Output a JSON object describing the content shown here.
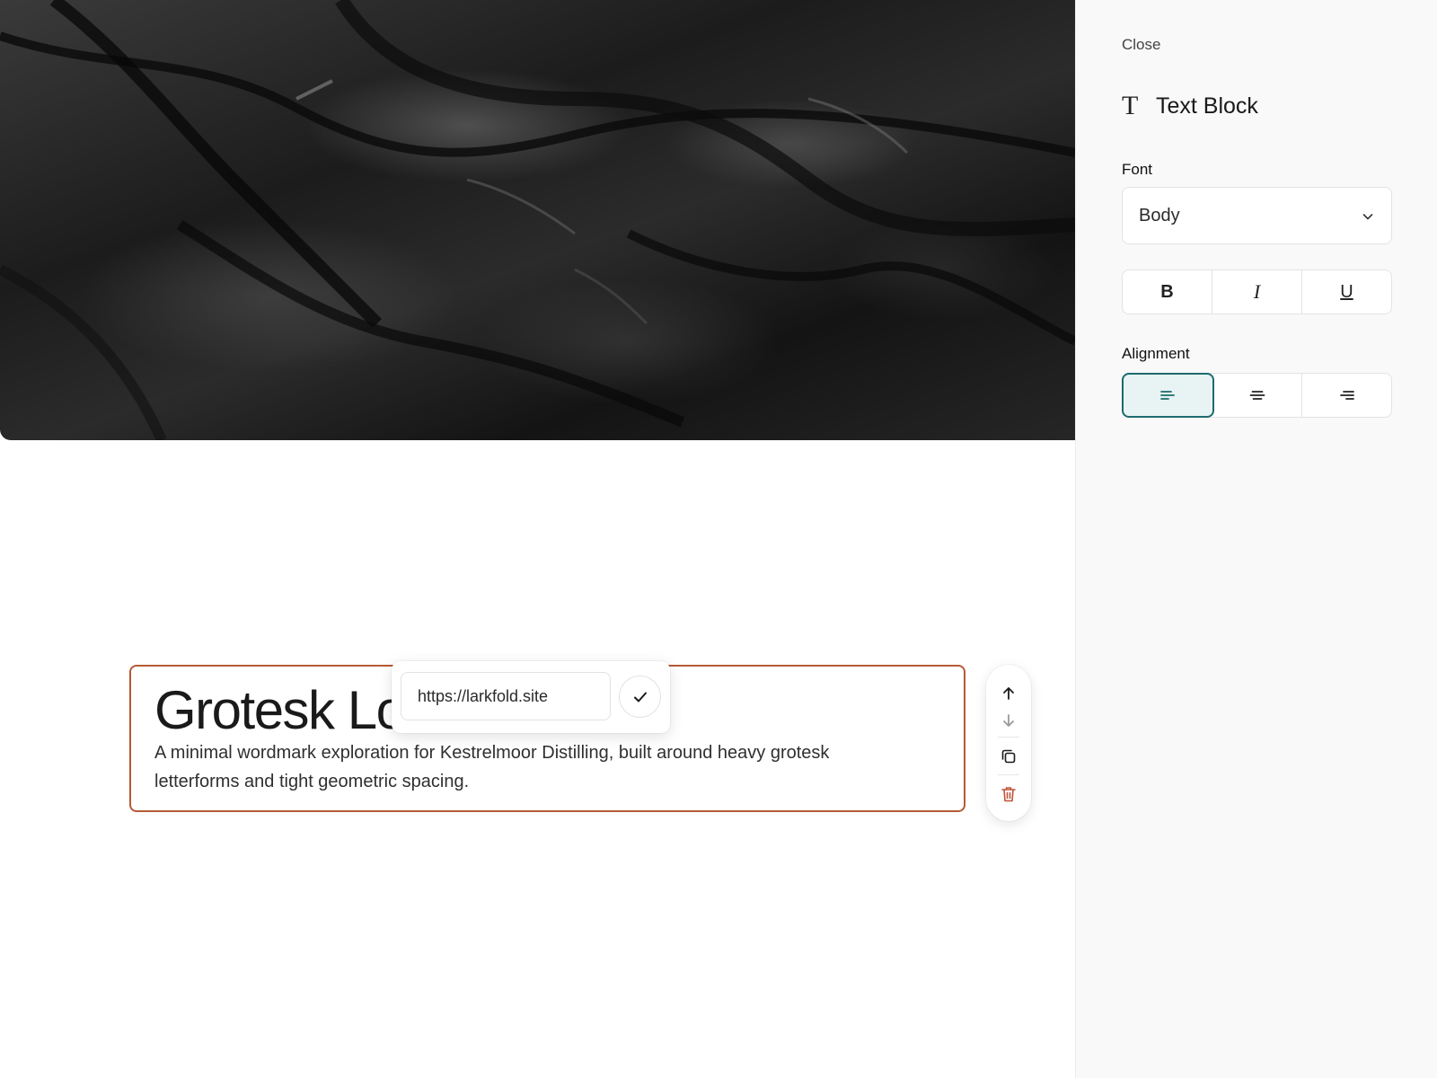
{
  "hero": {
    "image_name": "dark-crumpled-texture"
  },
  "text_block": {
    "title": "Grotesk Lo",
    "body": "A minimal wordmark exploration for Kestrelmoor Distilling, built around heavy grotesk letterforms and tight geometric spacing."
  },
  "link_popover": {
    "url_value": "https://larkfold.site",
    "confirm_icon": "check-icon"
  },
  "block_toolbar": {
    "icons": [
      "arrow-up-icon",
      "arrow-down-icon",
      "duplicate-icon",
      "trash-icon"
    ],
    "delete_color": "#c0533a"
  },
  "panel": {
    "close_label": "Close",
    "heading_icon": "T",
    "heading": "Text Block",
    "font_label": "Font",
    "font_value": "Body",
    "format_buttons": {
      "bold": "B",
      "italic": "I",
      "underline": "U"
    },
    "alignment_label": "Alignment",
    "alignment_selected": "left"
  },
  "colors": {
    "selection_border": "#b65a35",
    "accent": "#1d6b6e",
    "accent_bg": "#e8f3f3",
    "panel_bg": "#f9f9f9"
  }
}
